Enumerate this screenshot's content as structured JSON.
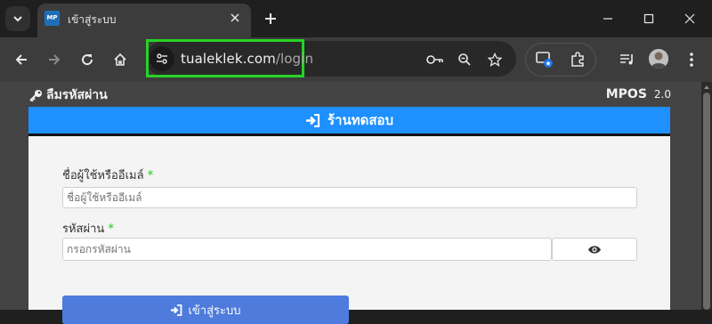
{
  "browser": {
    "tab": {
      "title": "เข้าสู่ระบบ",
      "favicon_text": "MP"
    },
    "url": {
      "host": "tualeklek.com",
      "path": "/login"
    },
    "highlight_color": "#27d327"
  },
  "page": {
    "forgot_password": "ลืมรหัสผ่าน",
    "brand": {
      "name": "MPOS",
      "version": "2.0"
    },
    "header": {
      "title": "ร้านทดสอบ",
      "color": "#1e90ff"
    },
    "form": {
      "username": {
        "label": "ชื่อผู้ใช้หรืออีเมล์",
        "required_mark": "*",
        "placeholder": "ชื่อผู้ใช้หรืออีเมล์"
      },
      "password": {
        "label": "รหัสผ่าน",
        "required_mark": "*",
        "placeholder": "กรอกรหัสผ่าน"
      },
      "login_button": "เข้าสู่ระบบ"
    }
  }
}
